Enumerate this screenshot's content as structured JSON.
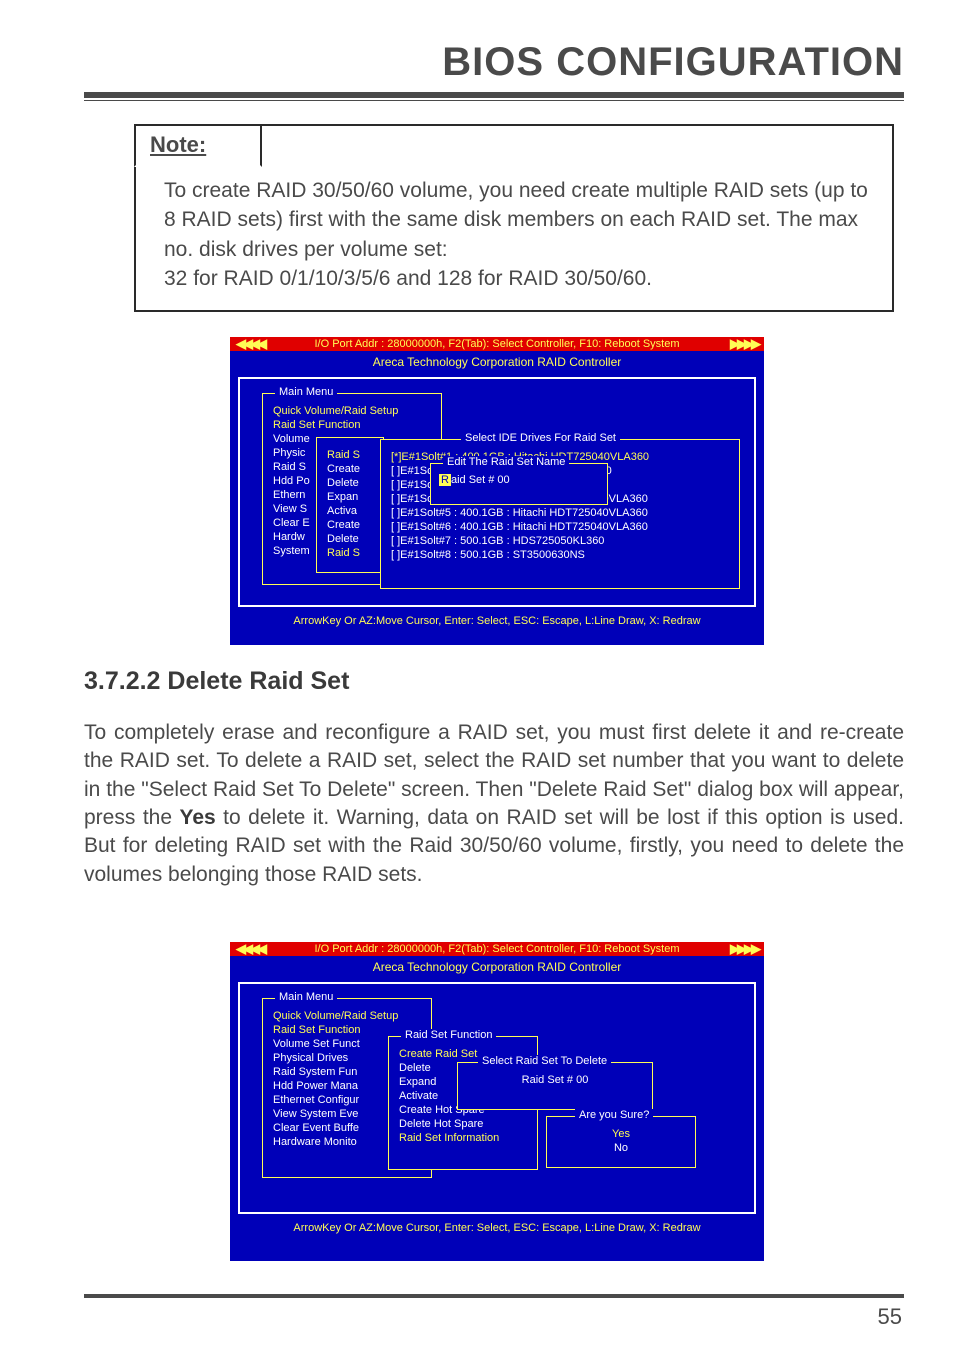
{
  "page": {
    "title": "BIOS CONFIGURATION",
    "number": "55"
  },
  "note": {
    "label": "Note:",
    "body": "To create RAID 30/50/60 volume, you need create multiple RAID sets (up to 8 RAID sets) first with the same disk members on each RAID set. The max no. disk drives per volume set:",
    "body2": "32 for RAID 0/1/10/3/5/6 and 128 for RAID 30/50/60."
  },
  "bios_common": {
    "red_bar": "I/O Port Addr : 28000000h, F2(Tab): Select Controller, F10: Reboot System",
    "sub_header": "Areca Technology Corporation RAID Controller",
    "footer": "ArrowKey Or AZ:Move Cursor, Enter: Select, ESC: Escape, L:Line Draw, X: Redraw",
    "arrows_left": "◀◀◀◀",
    "arrows_right": "▶▶▶▶"
  },
  "bios1": {
    "main_menu_title": "Main Menu",
    "main_menu_items": [
      "Quick Volume/Raid Setup",
      "Raid Set Function",
      "Volume",
      "Physic",
      "Raid S",
      "Hdd Po",
      "Ethern",
      "View S",
      "Clear E",
      "Hardw",
      "System"
    ],
    "raid_func_items": [
      "Raid S",
      "Create",
      "Delete",
      "Expan",
      "Activa",
      "Create",
      "Delete",
      "Raid S"
    ],
    "select_title": "Select IDE Drives For Raid Set",
    "select_items": [
      "[*]E#1Solt#1 : 400.1GB : Hitachi HDT725040VLA360",
      "[  ]E#1Solt#2 : 500.1GB : HDS725050KLA360",
      "[  ]E#1Solt#3 : 500.1GB : ST3500630NS",
      "[  ]E#1Solt#4 : 400.1GB : Hitachi HDT725040VLA360",
      "[  ]E#1Solt#5 : 400.1GB : Hitachi HDT725040VLA360",
      "[  ]E#1Solt#6 : 400.1GB : Hitachi HDT725040VLA360",
      "[  ]E#1Solt#7 : 500.1GB : HDS725050KL360",
      "[  ]E#1Solt#8 : 500.1GB : ST3500630NS"
    ],
    "edit_title": "Edit The Raid Set Name",
    "edit_value_prefix": "R",
    "edit_value_rest": "aid Set # 00"
  },
  "section": {
    "heading": "3.7.2.2 Delete Raid Set",
    "body_before_bold": "To completely erase and reconfigure a RAID set, you must first delete it and re-create the RAID set. To delete a RAID set, select the RAID set number that you want to delete in the \"Select Raid Set To Delete\" screen. Then \"Delete Raid Set\" dialog box will appear, press the ",
    "body_bold": "Yes",
    "body_after_bold": " to delete it. Warning, data on RAID set will be lost if this option is used. But for deleting RAID set with the Raid 30/50/60 volume, firstly, you need  to delete the volumes belonging those RAID sets."
  },
  "bios2": {
    "main_menu_title": "Main Menu",
    "main_menu_items": [
      "Quick Volume/Raid Setup",
      "Raid Set Function",
      "Volume Set Funct",
      "Physical Drives",
      "Raid System Fun",
      "Hdd Power Mana",
      "Ethernet Configur",
      "View System Eve",
      "Clear Event Buffe",
      "Hardware Monito"
    ],
    "raid_func_title": "Raid Set Function",
    "raid_func_items": [
      "Create Raid Set",
      "Delete ",
      "Expand",
      "Activate",
      "Create Hot Spare",
      "Delete Hot Spare",
      "Raid Set Information"
    ],
    "select_title": "Select Raid Set To Delete",
    "select_item": "Raid Set   #   00",
    "confirm_title": "Are you Sure?",
    "confirm_yes": "Yes",
    "confirm_no": "No"
  }
}
